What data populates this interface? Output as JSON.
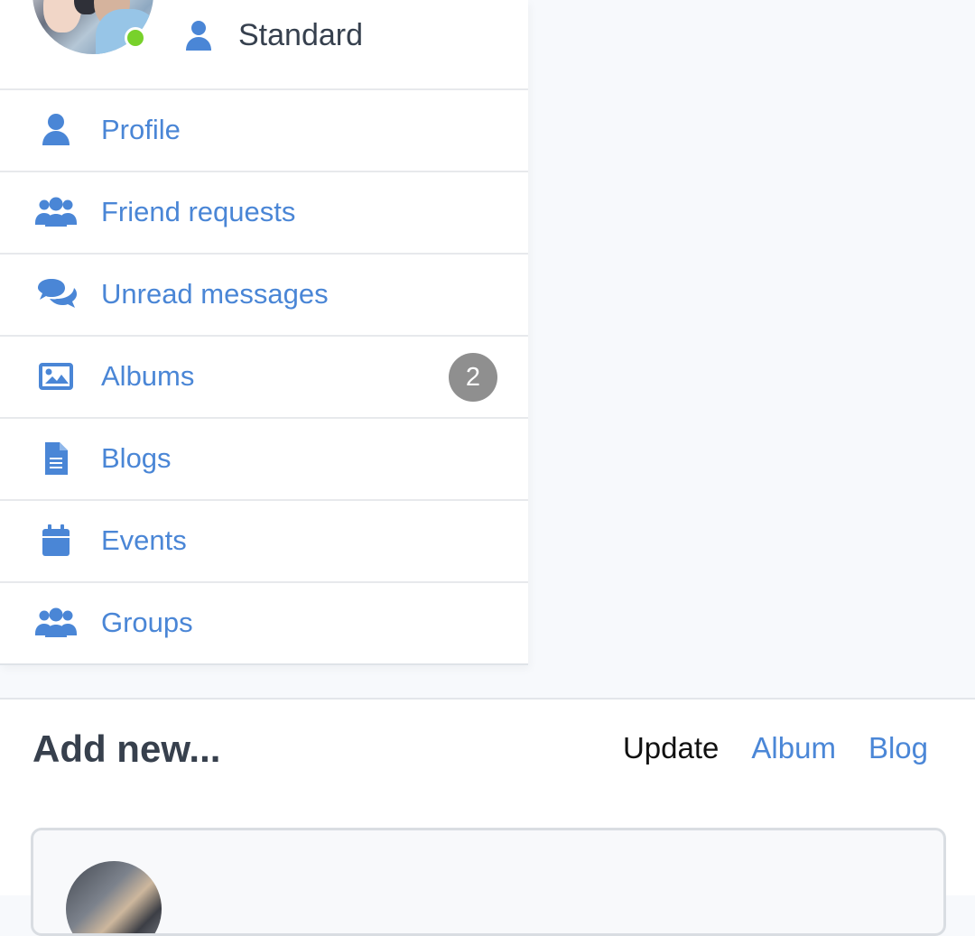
{
  "sidebar": {
    "user_type": "Standard",
    "items": [
      {
        "label": "Profile",
        "icon": "user-icon"
      },
      {
        "label": "Friend requests",
        "icon": "users-icon"
      },
      {
        "label": "Unread messages",
        "icon": "chat-bubbles-icon"
      },
      {
        "label": "Albums",
        "icon": "image-icon",
        "badge": "2"
      },
      {
        "label": "Blogs",
        "icon": "document-icon"
      },
      {
        "label": "Events",
        "icon": "calendar-icon"
      },
      {
        "label": "Groups",
        "icon": "users-icon"
      }
    ]
  },
  "add_new": {
    "title": "Add new...",
    "tabs": [
      "Update",
      "Album",
      "Blog"
    ]
  },
  "colors": {
    "accent": "#4A86D6",
    "online": "#78D12B",
    "badge": "#8F8F8F",
    "text_dark": "#36404E"
  }
}
